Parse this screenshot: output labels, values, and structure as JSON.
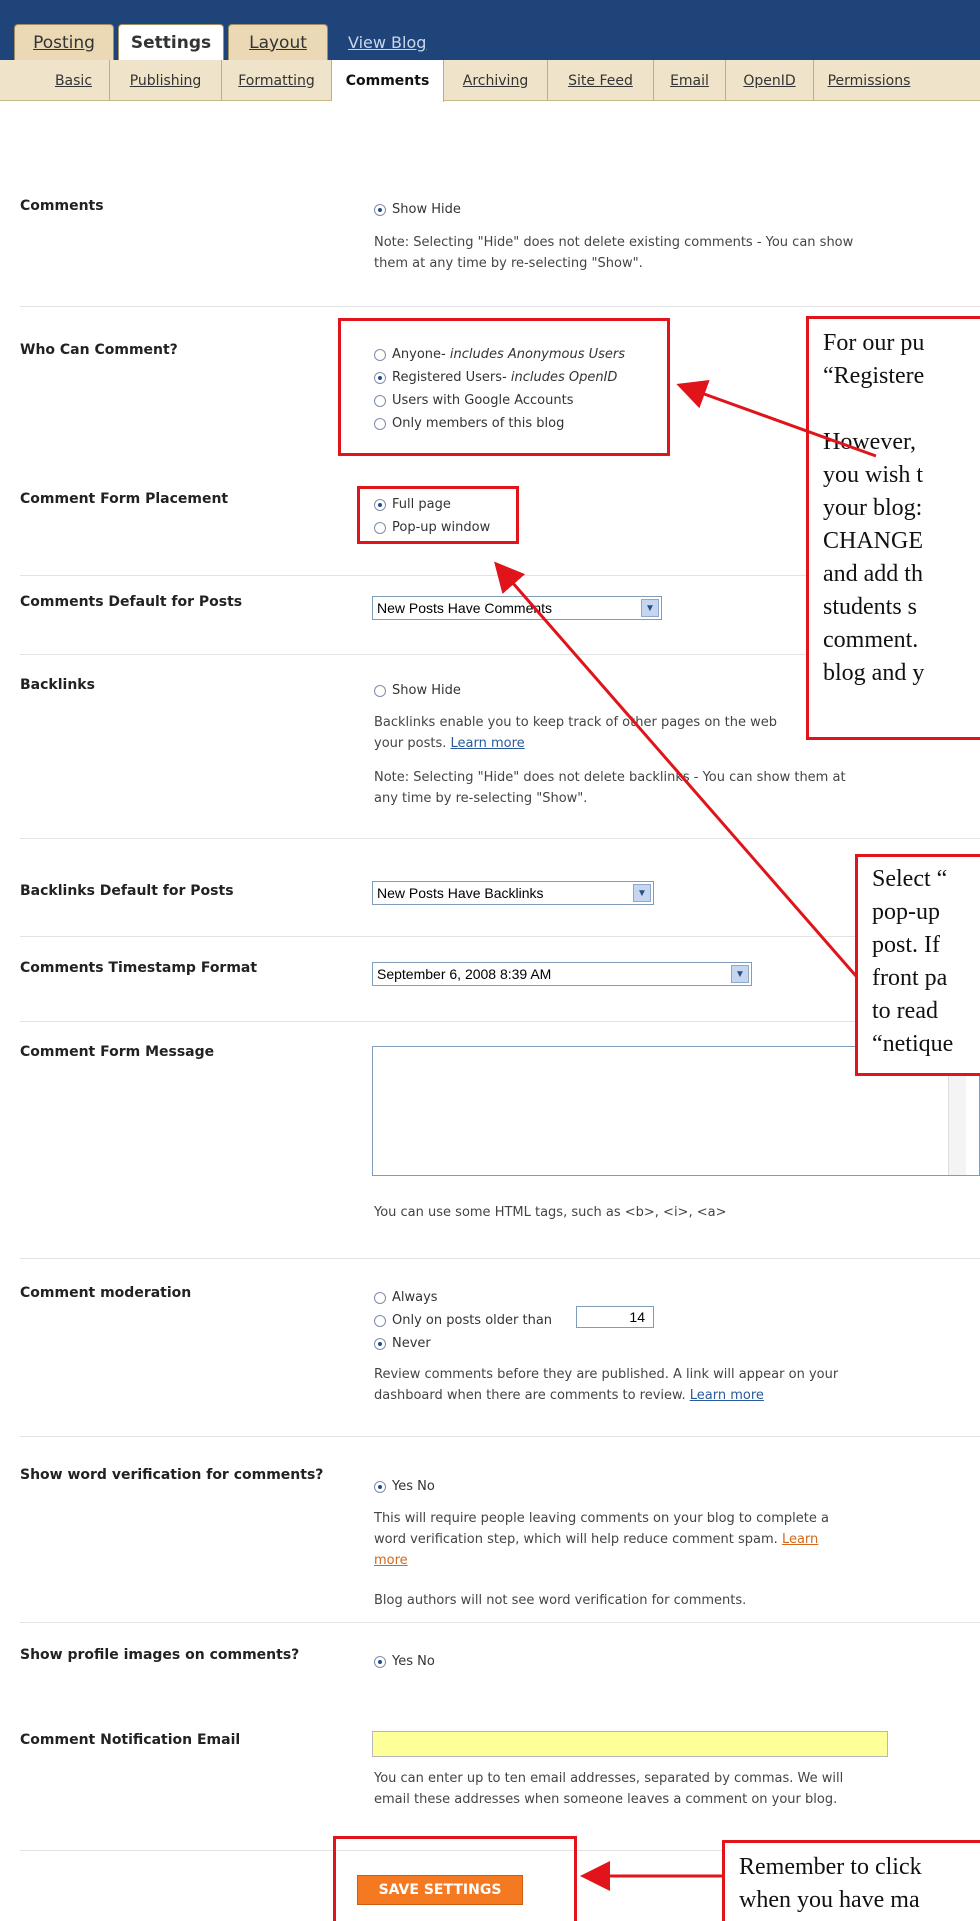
{
  "tabs": {
    "posting": "Posting",
    "settings": "Settings",
    "layout": "Layout",
    "view_blog": "View Blog"
  },
  "subtabs": [
    "Basic",
    "Publishing",
    "Formatting",
    "Comments",
    "Archiving",
    "Site Feed",
    "Email",
    "OpenID",
    "Permissions"
  ],
  "comments": {
    "label": "Comments",
    "option": "Show Hide",
    "note": "Note: Selecting \"Hide\" does not delete existing comments - You can show",
    "note2": "them at any time by re-selecting \"Show\"."
  },
  "who": {
    "label": "Who Can Comment?",
    "o1": "Anyone",
    "o1i": " - includes Anonymous Users",
    "o2": "Registered Users",
    "o2i": " - includes OpenID",
    "o3": "Users with Google Accounts",
    "o4": "Only members of this blog"
  },
  "placement": {
    "label": "Comment Form Placement",
    "o1": "Full page",
    "o2": "Pop-up window"
  },
  "defaults": {
    "label": "Comments Default for Posts",
    "value": "New Posts Have Comments"
  },
  "backlinks": {
    "label": "Backlinks",
    "option": "Show Hide",
    "d1": "Backlinks enable you to keep track of other pages on the web",
    "d2": "your posts.",
    "learn": "Learn more",
    "n1": "Note: Selecting \"Hide\" does not delete backlinks - You can show them at",
    "n2": "any time by re-selecting \"Show\"."
  },
  "bdefaults": {
    "label": "Backlinks Default for Posts",
    "value": "New Posts Have Backlinks"
  },
  "timestamp": {
    "label": "Comments Timestamp Format",
    "value": "September 6, 2008 8:39 AM"
  },
  "formmsg": {
    "label": "Comment Form Message",
    "hint": "You can use some HTML tags, such as <b>, <i>, <a>"
  },
  "moderation": {
    "label": "Comment moderation",
    "o1": "Always",
    "o2": "Only on posts older than",
    "days": "14",
    "o3": "Never",
    "d1": "Review comments before they are published. A link will appear on your",
    "d2": "dashboard when there are comments to review.",
    "learn": "Learn more"
  },
  "wordver": {
    "label": "Show word verification for comments?",
    "option": "Yes No",
    "d1": "This will require people leaving comments on your blog to complete a",
    "d2": "word verification step, which will help reduce comment spam.",
    "learn1": "Learn",
    "learn2": "more",
    "d3": "Blog authors will not see word verification for comments."
  },
  "profile": {
    "label": "Show profile images on comments?",
    "option": "Yes No"
  },
  "notify": {
    "label": "Comment Notification Email",
    "d1": "You can enter up to ten email addresses, separated by commas. We will",
    "d2": "email these addresses when someone leaves a comment on your blog."
  },
  "save_label": "SAVE SETTINGS",
  "notes": {
    "n1": [
      "For our pu",
      "“Registere",
      "",
      "However, ",
      "you wish t",
      "your blog:",
      "CHANGE",
      "and add th",
      "students s",
      "comment.",
      "blog and y"
    ],
    "n2": [
      "Select “",
      "pop-up",
      "post. If",
      "front pa",
      "to read",
      "“netique"
    ],
    "n3": [
      "Remember to click",
      "when you have ma"
    ]
  }
}
